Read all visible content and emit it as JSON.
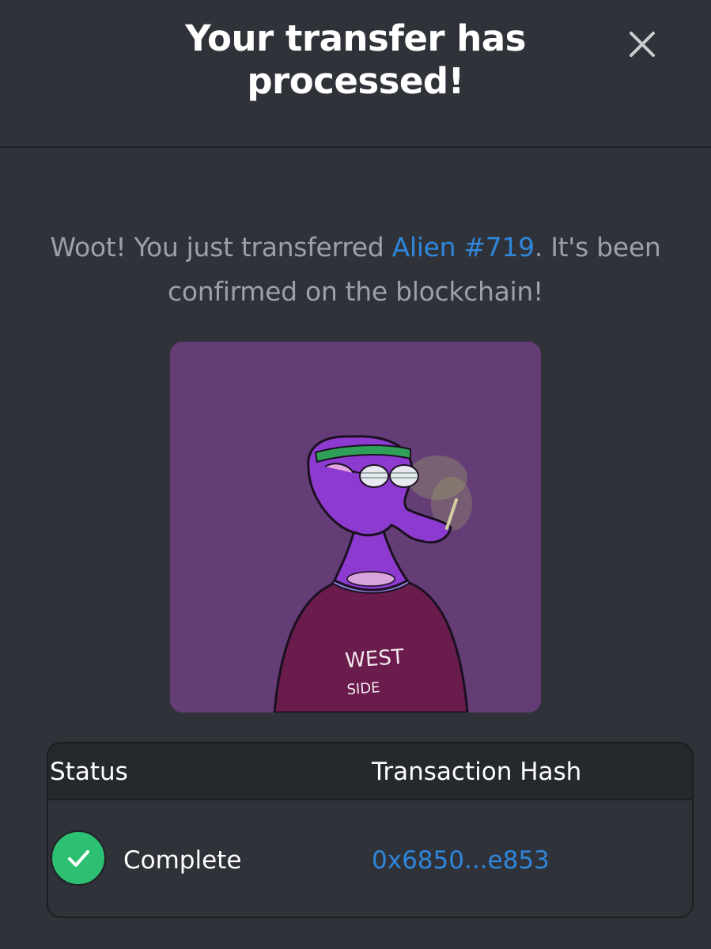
{
  "modal": {
    "title": "Your transfer has processed!",
    "close_icon": "close-icon"
  },
  "message": {
    "before": "Woot! You just transferred ",
    "link": "Alien #719",
    "after": ". It's been confirmed on the blockchain!"
  },
  "nft": {
    "name": "Alien #719",
    "shirt_text_line1": "WEST",
    "shirt_text_line2": "SIDE",
    "background_color": "#643d77"
  },
  "table": {
    "headers": [
      "Status",
      "Transaction Hash"
    ],
    "row": {
      "status_icon": "check-icon",
      "status": "Complete",
      "hash": "0x6850...e853"
    }
  },
  "colors": {
    "background": "#2f3238",
    "link": "#2f86db",
    "success": "#2dbf72"
  }
}
